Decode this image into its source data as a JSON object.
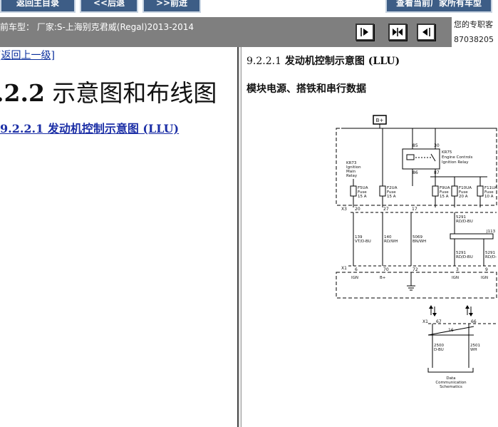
{
  "nav": {
    "home_label": "返回主目录",
    "back_label": "<<后退",
    "forward_label": ">>前进",
    "all_models_label": "查看当前厂家所有车型"
  },
  "infobar": {
    "vehicle_text": "前车型： 厂家:S-上海别克君威(Regal)2013-2014",
    "contact_line1": "您的专职客",
    "contact_line2": "87038205"
  },
  "left": {
    "up_link": "返回上一级]",
    "heading_number": ".2.2",
    "heading_text": " 示意图和布线图",
    "sub_link": "9.2.2.1 发动机控制示意图 (LLU)"
  },
  "right": {
    "title_number": "9.2.2.1",
    "title_text": " 发动机控制示意图 (LLU)",
    "subtitle": "模块电源、搭铁和串行数据"
  },
  "diagram": {
    "bplus_box": "B+",
    "kr75_pins_top": [
      "85",
      "30"
    ],
    "kr75_pins_bottom": [
      "86",
      "87"
    ],
    "kr75_label": [
      "KR75",
      "Engine Controls",
      "Ignition Relay"
    ],
    "kr73_label": [
      "KR73",
      "Ignition",
      "Main",
      "Relay"
    ],
    "fuses": [
      {
        "name": "F5UA",
        "type": "Fuse",
        "amps": "15 A"
      },
      {
        "name": "F2UA",
        "type": "Fuse",
        "amps": "15 A"
      },
      {
        "name": "F9UA",
        "type": "Fuse",
        "amps": "15 A"
      },
      {
        "name": "F10UA",
        "type": "Fuse",
        "amps": "20 A"
      },
      {
        "name": "F11UA",
        "type": "Fuse",
        "amps": "10 A"
      }
    ],
    "x3_label": "X3",
    "x3_pins": [
      "20",
      "27",
      "17"
    ],
    "wires_mid": [
      {
        "num": "139",
        "color": "VT/D-BU"
      },
      {
        "num": "140",
        "color": "RD/WH"
      },
      {
        "num": "5069",
        "color": "BN/WH"
      }
    ],
    "wire_5291_top": [
      "5291",
      "RD/D-BU"
    ],
    "j113_label": "J113",
    "wire_5291_a": [
      "5291",
      "RD/D-BU"
    ],
    "wire_5291_b": [
      "5291",
      "RD/D-"
    ],
    "x1_label": "X1",
    "x1_pins": [
      "6",
      "70",
      "72",
      "3",
      "9"
    ],
    "x1_labels": [
      "IGN",
      "B+",
      "IGN",
      "IGN"
    ],
    "x1b_label": "X1",
    "x1b_pins": [
      "67",
      "66"
    ],
    "twist_label": "16",
    "wires_bottom": [
      {
        "num": "2500",
        "color": "D-BU"
      },
      {
        "num": "2501",
        "color": "WH"
      }
    ],
    "dcs_label": [
      "Data",
      "Communication",
      "Schematics"
    ]
  }
}
